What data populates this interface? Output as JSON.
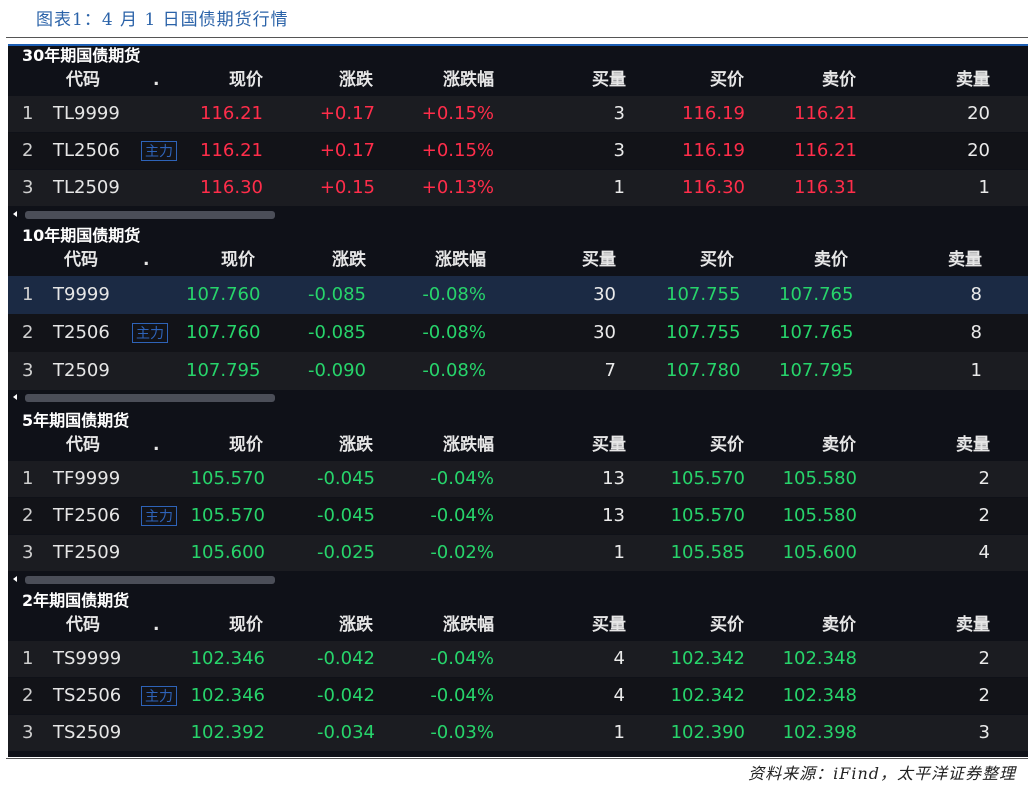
{
  "figure_title": "图表1：4 月 1 日国债期货行情",
  "source": "资料来源：iFind，太平洋证券整理",
  "colors": {
    "up": "#ff2d4a",
    "down": "#27d46b",
    "accent": "#1d5fb5",
    "background": "#0f1118"
  },
  "header": {
    "code": "代码",
    "dot": ".",
    "price": "现价",
    "change": "涨跌",
    "change_pct": "涨跌幅",
    "bid_vol": "买量",
    "bid": "买价",
    "ask": "卖价",
    "ask_vol": "卖量"
  },
  "main_tag": "主力",
  "sections": [
    {
      "title": "30年期国债期货",
      "rows": [
        {
          "n": "1",
          "code": "TL9999",
          "price": "116.21",
          "change": "+0.17",
          "pct": "+0.15%",
          "bid_vol": "3",
          "bid": "116.19",
          "ask": "116.21",
          "ask_vol": "20"
        },
        {
          "n": "2",
          "code": "TL2506",
          "price": "116.21",
          "change": "+0.17",
          "pct": "+0.15%",
          "bid_vol": "3",
          "bid": "116.19",
          "ask": "116.21",
          "ask_vol": "20"
        },
        {
          "n": "3",
          "code": "TL2509",
          "price": "116.30",
          "change": "+0.15",
          "pct": "+0.13%",
          "bid_vol": "1",
          "bid": "116.30",
          "ask": "116.31",
          "ask_vol": "1"
        }
      ]
    },
    {
      "title": "10年期国债期货",
      "rows": [
        {
          "n": "1",
          "code": "T9999",
          "price": "107.760",
          "change": "-0.085",
          "pct": "-0.08%",
          "bid_vol": "30",
          "bid": "107.755",
          "ask": "107.765",
          "ask_vol": "8"
        },
        {
          "n": "2",
          "code": "T2506",
          "price": "107.760",
          "change": "-0.085",
          "pct": "-0.08%",
          "bid_vol": "30",
          "bid": "107.755",
          "ask": "107.765",
          "ask_vol": "8"
        },
        {
          "n": "3",
          "code": "T2509",
          "price": "107.795",
          "change": "-0.090",
          "pct": "-0.08%",
          "bid_vol": "7",
          "bid": "107.780",
          "ask": "107.795",
          "ask_vol": "1"
        }
      ]
    },
    {
      "title": "5年期国债期货",
      "rows": [
        {
          "n": "1",
          "code": "TF9999",
          "price": "105.570",
          "change": "-0.045",
          "pct": "-0.04%",
          "bid_vol": "13",
          "bid": "105.570",
          "ask": "105.580",
          "ask_vol": "2"
        },
        {
          "n": "2",
          "code": "TF2506",
          "price": "105.570",
          "change": "-0.045",
          "pct": "-0.04%",
          "bid_vol": "13",
          "bid": "105.570",
          "ask": "105.580",
          "ask_vol": "2"
        },
        {
          "n": "3",
          "code": "TF2509",
          "price": "105.600",
          "change": "-0.025",
          "pct": "-0.02%",
          "bid_vol": "1",
          "bid": "105.585",
          "ask": "105.600",
          "ask_vol": "4"
        }
      ]
    },
    {
      "title": "2年期国债期货",
      "rows": [
        {
          "n": "1",
          "code": "TS9999",
          "price": "102.346",
          "change": "-0.042",
          "pct": "-0.04%",
          "bid_vol": "4",
          "bid": "102.342",
          "ask": "102.348",
          "ask_vol": "2"
        },
        {
          "n": "2",
          "code": "TS2506",
          "price": "102.346",
          "change": "-0.042",
          "pct": "-0.04%",
          "bid_vol": "4",
          "bid": "102.342",
          "ask": "102.348",
          "ask_vol": "2"
        },
        {
          "n": "3",
          "code": "TS2509",
          "price": "102.392",
          "change": "-0.034",
          "pct": "-0.03%",
          "bid_vol": "1",
          "bid": "102.390",
          "ask": "102.398",
          "ask_vol": "3"
        }
      ]
    }
  ]
}
